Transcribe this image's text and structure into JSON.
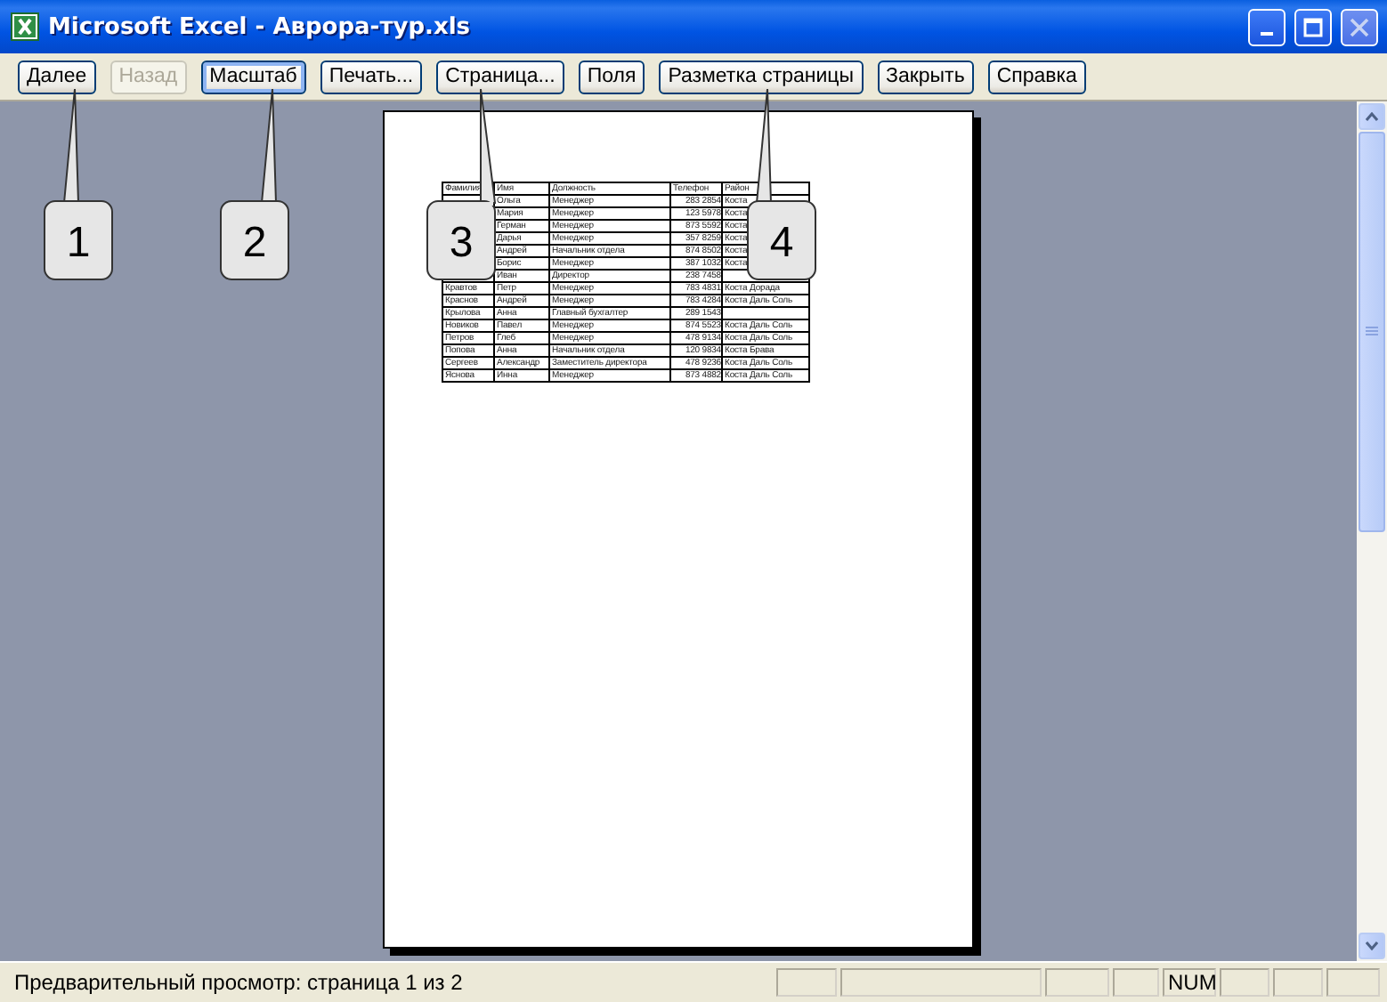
{
  "window": {
    "title": "Microsoft Excel - Аврора-тур.xls"
  },
  "toolbar": [
    {
      "label": "Далее",
      "disabled": false,
      "focused": false
    },
    {
      "label": "Назад",
      "disabled": true,
      "focused": false
    },
    {
      "label": "Масштаб",
      "disabled": false,
      "focused": true
    },
    {
      "label": "Печать...",
      "disabled": false,
      "focused": false
    },
    {
      "label": "Страница...",
      "disabled": false,
      "focused": false
    },
    {
      "label": "Поля",
      "disabled": false,
      "focused": false
    },
    {
      "label": "Разметка страницы",
      "disabled": false,
      "focused": false
    },
    {
      "label": "Закрыть",
      "disabled": false,
      "focused": false
    },
    {
      "label": "Справка",
      "disabled": false,
      "focused": false
    }
  ],
  "table": {
    "columns": [
      "Фамилия",
      "Имя",
      "Должность",
      "Телефон",
      "Район"
    ],
    "rows": [
      [
        null,
        "Ольга",
        "Менеджер",
        "283 2854",
        "Коста"
      ],
      [
        null,
        "Мария",
        "Менеджер",
        "123 5978",
        "Коста"
      ],
      [
        null,
        "Герман",
        "Менеджер",
        "873 5592",
        "Коста"
      ],
      [
        null,
        "Дарья",
        "Менеджер",
        "357 8259",
        "Коста"
      ],
      [
        null,
        "Андрей",
        "Начальник отдела",
        "874 8502",
        "Коста"
      ],
      [
        null,
        "Борис",
        "Менеджер",
        "387 1032",
        "Коста"
      ],
      [
        null,
        "Иван",
        "Директор",
        "238 7458",
        null
      ],
      [
        "Кравтов",
        "Петр",
        "Менеджер",
        "783 4831",
        "Коста Дорада"
      ],
      [
        "Краснов",
        "Андрей",
        "Менеджер",
        "783 4284",
        "Коста Даль Соль"
      ],
      [
        "Крылова",
        "Анна",
        "Главный бухгалтер",
        "289 1543",
        null
      ],
      [
        "Новиков",
        "Павел",
        "Менеджер",
        "874 5523",
        "Коста Даль Соль"
      ],
      [
        "Петров",
        "Глеб",
        "Менеджер",
        "478 9134",
        "Коста Даль Соль"
      ],
      [
        "Попова",
        "Анна",
        "Начальник отдела",
        "120 9834",
        "Коста Брава"
      ],
      [
        "Сергеев",
        "Александр",
        "Заместитель директора",
        "478 9236",
        "Коста Даль Соль"
      ],
      [
        "Яснова",
        "Инна",
        "Менеджер",
        "873 4882",
        "Коста Даль Соль"
      ]
    ]
  },
  "callouts": [
    {
      "number": "1"
    },
    {
      "number": "2"
    },
    {
      "number": "3"
    },
    {
      "number": "4"
    }
  ],
  "status_bar": {
    "text": "Предварительный просмотр: страница 1 из 2",
    "indicators": [
      "NUM"
    ]
  }
}
